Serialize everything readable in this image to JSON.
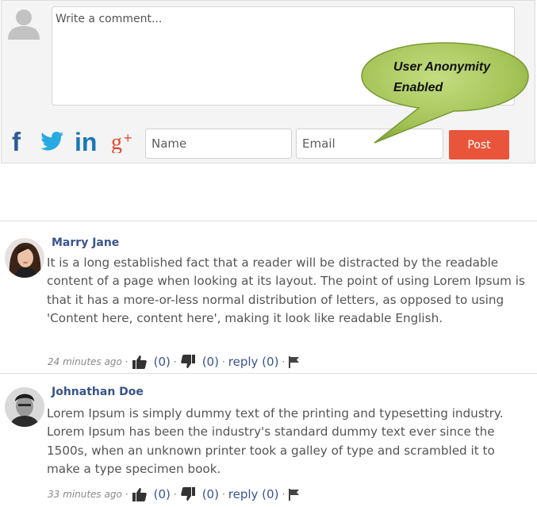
{
  "composer": {
    "comment_placeholder": "Write a comment...",
    "name_placeholder": "Name",
    "email_placeholder": "Email",
    "post_label": "Post",
    "social_icons": [
      "facebook-icon",
      "twitter-icon",
      "linkedin-icon",
      "google-plus-icon"
    ],
    "colors": {
      "facebook": "#2d5c97",
      "twitter": "#29a9e1",
      "linkedin": "#1a77b5",
      "google_plus": "#df4a32",
      "post": "#e8553b"
    }
  },
  "callout": {
    "line1": "User Anonymity",
    "line2": "Enabled",
    "color": "#a9c95a"
  },
  "comments": [
    {
      "author": "Marry Jane",
      "text": "It is a long established fact that a reader will be distracted by the readable content of a page when looking at its layout. The point of using Lorem Ipsum is that it has a more-or-less normal distribution of letters, as opposed to using 'Content here, content here', making it look like readable English.",
      "time": "24 minutes ago",
      "likes": "(0)",
      "dislikes": "(0)",
      "reply": "reply (0)"
    },
    {
      "author": "Johnathan Doe",
      "text": "Lorem Ipsum is simply dummy text of the printing and typesetting industry. Lorem Ipsum has been the industry's standard dummy text ever since the 1500s, when an unknown printer took a galley of type and scrambled it to make a type specimen book.",
      "time": "33 minutes ago",
      "likes": "(0)",
      "dislikes": "(0)",
      "reply": "reply (0)"
    }
  ]
}
